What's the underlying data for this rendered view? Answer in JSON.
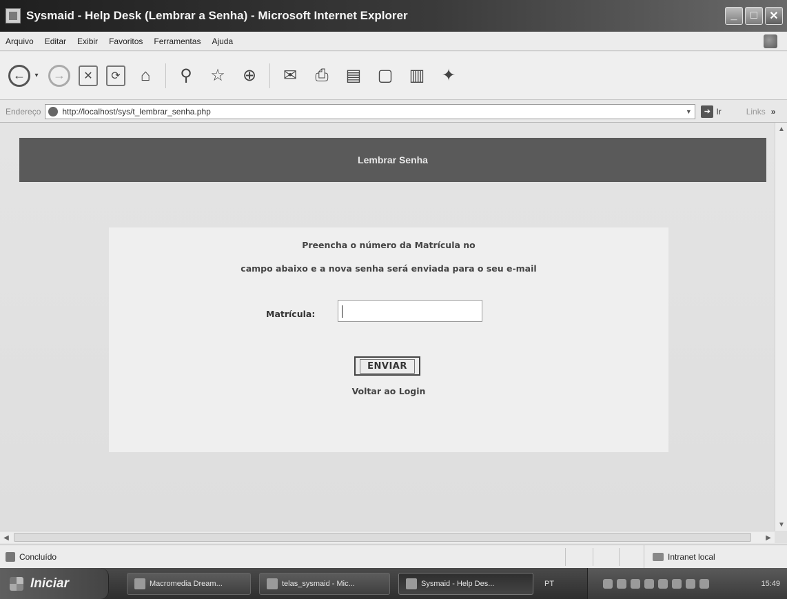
{
  "window": {
    "title": "Sysmaid - Help Desk (Lembrar a Senha) - Microsoft Internet Explorer"
  },
  "menu": {
    "items": [
      "Arquivo",
      "Editar",
      "Exibir",
      "Favoritos",
      "Ferramentas",
      "Ajuda"
    ]
  },
  "address": {
    "label": "Endereço",
    "url": "http://localhost/sys/t_lembrar_senha.php",
    "go_label": "Ir",
    "links_label": "Links",
    "chevron": "»"
  },
  "page": {
    "banner_title": "Lembrar Senha",
    "instruction_line1": "Preencha o número da Matrícula no",
    "instruction_line2": "campo abaixo e a nova senha será enviada para o seu e-mail",
    "matricula_label": "Matrícula:",
    "matricula_value": "",
    "submit_label": "ENVIAR",
    "back_link": "Voltar ao Login"
  },
  "status": {
    "text": "Concluído",
    "zone": "Intranet local"
  },
  "taskbar": {
    "start_label": "Iniciar",
    "tasks": [
      {
        "label": "Macromedia Dream...",
        "active": false
      },
      {
        "label": "telas_sysmaid - Mic...",
        "active": false
      },
      {
        "label": "Sysmaid - Help Des...",
        "active": true
      }
    ],
    "language": "PT",
    "clock": "15:49"
  },
  "toolbar": {
    "icons": [
      "back-icon",
      "forward-icon",
      "stop-icon",
      "refresh-icon",
      "home-icon",
      "search-icon",
      "favorites-icon",
      "history-icon",
      "mail-icon",
      "print-icon",
      "edit-icon",
      "discuss-icon",
      "research-icon",
      "messenger-icon"
    ]
  }
}
